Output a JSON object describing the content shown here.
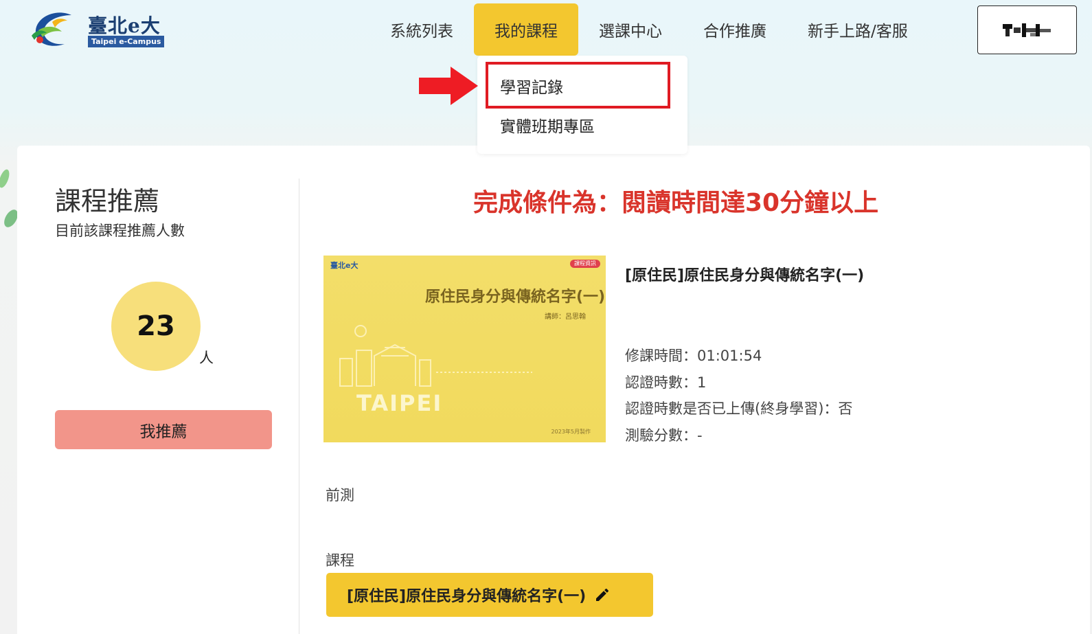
{
  "logo": {
    "title": "臺北e大",
    "subtitle": "Taipei e-Campus"
  },
  "nav": {
    "items": [
      {
        "label": "系統列表"
      },
      {
        "label": "我的課程"
      },
      {
        "label": "選課中心"
      },
      {
        "label": "合作推廣"
      },
      {
        "label": "新手上路/客服"
      }
    ],
    "active_index": 1
  },
  "dropdown": {
    "items": [
      {
        "label": "學習記錄"
      },
      {
        "label": "實體班期專區"
      }
    ]
  },
  "recommend": {
    "title": "課程推薦",
    "subtitle": "目前該課程推薦人數",
    "count": "23",
    "unit": "人",
    "button_label": "我推薦"
  },
  "headline": "完成條件為：閱讀時間達30分鐘以上",
  "course": {
    "thumbnail": {
      "logo_text": "臺北e大",
      "badge": "課程資訊",
      "title": "原住民身分與傳統名字(一)",
      "teacher": "講師：呂思翰",
      "city": "TAIPEI",
      "date": "2023年5月製作"
    },
    "name": "[原住民]原住民身分與傳統名字(一)",
    "info": [
      "修課時間：01:01:54",
      "認證時數：1",
      "認證時數是否已上傳(終身學習)：否",
      "測驗分數：-"
    ],
    "section_pretest": "前測",
    "section_course": "課程",
    "course_button_label": "[原住民]原住民身分與傳統名字(一)"
  },
  "colors": {
    "accent_yellow": "#f3c72f",
    "highlight_red": "#e01b23",
    "headline_red": "#d9342b",
    "recommend_button": "#f2958a",
    "count_circle": "#f7df7b"
  }
}
